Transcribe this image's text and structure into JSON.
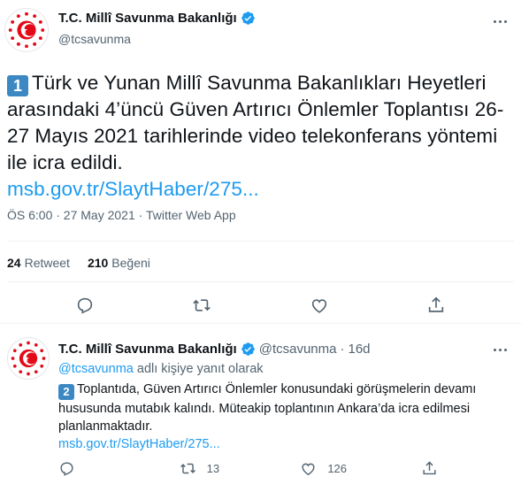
{
  "main_tweet": {
    "display_name": "T.C. Millî Savunma Bakanlığı",
    "handle": "@tcsavunma",
    "badge": "1",
    "text": "Türk ve Yunan Millî Savunma Bakanlıkları Heyetleri arasındaki 4’üncü Güven Artırıcı Önlemler Toplantısı 26-27 Mayıs 2021 tarihlerinde video telekonferans yöntemi ile icra edildi.",
    "link": "msb.gov.tr/SlaytHaber/275...",
    "meta": "ÖS 6:00 · 27 May 2021 · Twitter Web App",
    "retweets_count": "24",
    "retweets_label": "Retweet",
    "likes_count": "210",
    "likes_label": "Beğeni"
  },
  "reply_tweet": {
    "display_name": "T.C. Millî Savunma Bakanlığı",
    "handle": "@tcsavunma",
    "separator": "·",
    "age": "16d",
    "reply_to_handle": "@tcsavunma",
    "reply_to_suffix": "adlı kişiye yanıt olarak",
    "badge": "2",
    "text": "Toplantıda, Güven Artırıcı Önlemler konusundaki görüşmelerin devamı hususunda mutabık kalındı. Müteakip toplantının Ankara’da icra edilmesi planlanmaktadır.",
    "link": "msb.gov.tr/SlaytHaber/275...",
    "retweet_count": "13",
    "like_count": "126"
  },
  "colors": {
    "accent": "#1d9bf0",
    "secondary_text": "#536471",
    "badge_blue": "#3b88c3",
    "logo_red": "#e30a17"
  },
  "icons": [
    "verified-icon",
    "more-icon",
    "reply-icon",
    "retweet-icon",
    "like-icon",
    "share-icon",
    "msb-logo"
  ]
}
